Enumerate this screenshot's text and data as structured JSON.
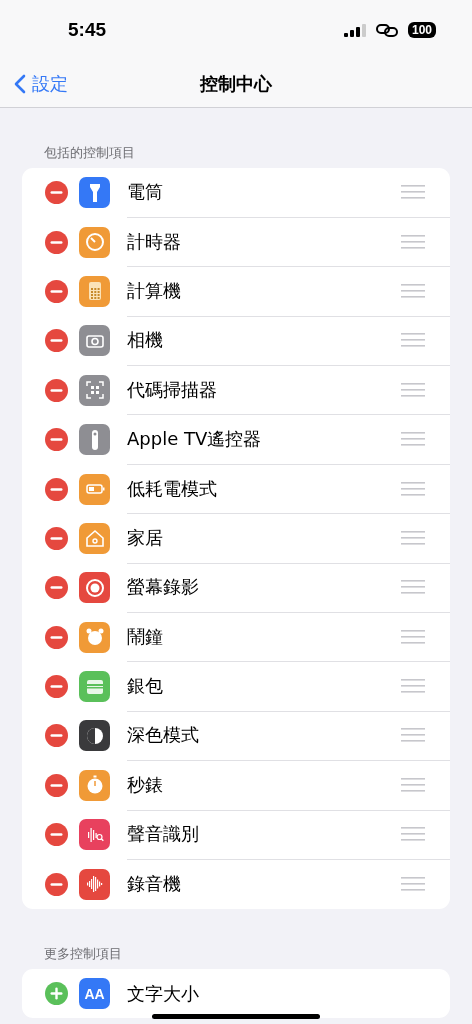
{
  "status_bar": {
    "time": "5:45",
    "battery": "100"
  },
  "nav": {
    "back": "設定",
    "title": "控制中心"
  },
  "sections": [
    {
      "header": "包括的控制項目",
      "items": [
        {
          "label": "電筒",
          "kind": "flashlight",
          "color": "#3478f6",
          "included": true
        },
        {
          "label": "計時器",
          "kind": "timer",
          "color": "#f09a37",
          "included": true
        },
        {
          "label": "計算機",
          "kind": "calculator",
          "color": "#f09a37",
          "included": true
        },
        {
          "label": "相機",
          "kind": "camera",
          "color": "#8e8e93",
          "included": true
        },
        {
          "label": "代碼掃描器",
          "kind": "qr",
          "color": "#8e8e93",
          "included": true
        },
        {
          "label": "Apple TV遙控器",
          "kind": "remote",
          "color": "#8e8e93",
          "included": true
        },
        {
          "label": "低耗電模式",
          "kind": "battery",
          "color": "#f09a37",
          "included": true
        },
        {
          "label": "家居",
          "kind": "home",
          "color": "#f09a37",
          "included": true
        },
        {
          "label": "螢幕錄影",
          "kind": "record",
          "color": "#e5483f",
          "included": true
        },
        {
          "label": "鬧鐘",
          "kind": "alarm",
          "color": "#f09a37",
          "included": true
        },
        {
          "label": "銀包",
          "kind": "wallet",
          "color": "#5ac05a",
          "included": true
        },
        {
          "label": "深色模式",
          "kind": "darkmode",
          "color": "#3a3a3c",
          "included": true
        },
        {
          "label": "秒錶",
          "kind": "stopwatch",
          "color": "#f09a37",
          "included": true
        },
        {
          "label": "聲音識別",
          "kind": "sound",
          "color": "#e8415e",
          "included": true
        },
        {
          "label": "錄音機",
          "kind": "waveform",
          "color": "#e5483f",
          "included": true
        }
      ]
    },
    {
      "header": "更多控制項目",
      "items": [
        {
          "label": "文字大小",
          "kind": "text",
          "icon_text": "AA",
          "color": "#3478f6",
          "included": false
        }
      ]
    }
  ]
}
